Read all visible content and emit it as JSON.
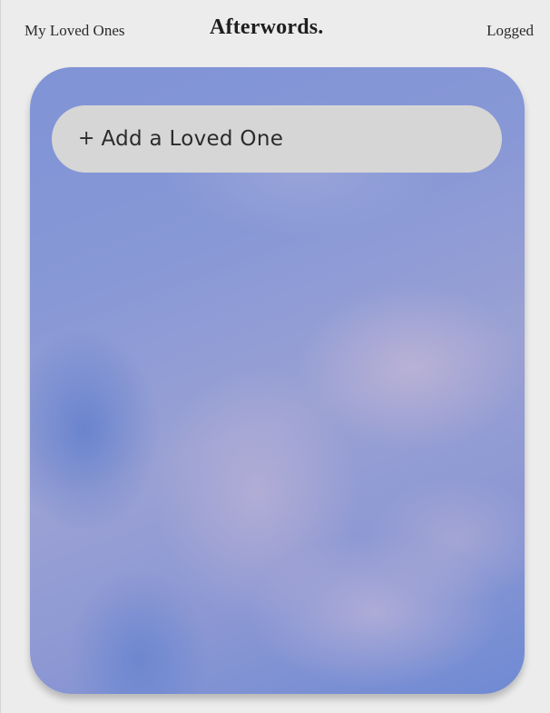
{
  "header": {
    "nav_left_label": "My Loved Ones",
    "brand_title": "Afterwords.",
    "nav_right_label": "Logged"
  },
  "main": {
    "add_button": {
      "icon": "plus-icon",
      "icon_glyph": "+",
      "label": "Add a Loved One"
    }
  },
  "colors": {
    "page_background": "#ececec",
    "button_background": "#d6d6d6",
    "text": "#2b2b2b",
    "sky_blue": "#7f93d6"
  }
}
